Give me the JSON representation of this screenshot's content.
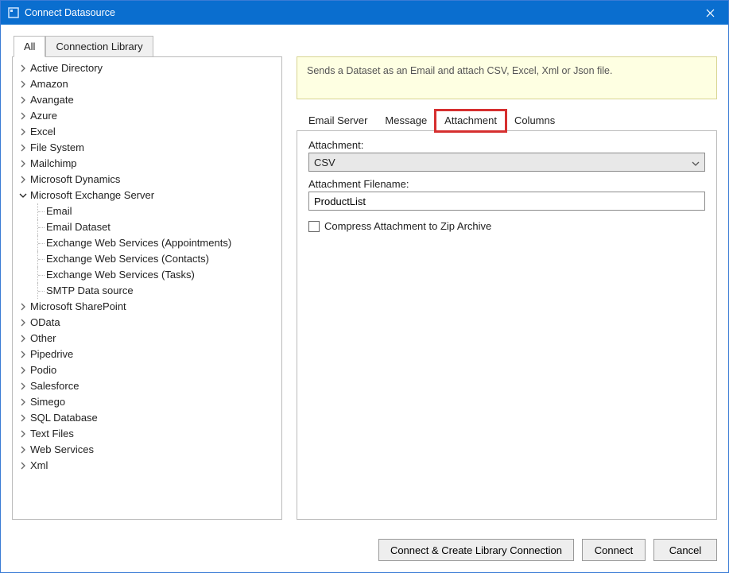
{
  "window": {
    "title": "Connect Datasource"
  },
  "mainTabs": {
    "active": 0,
    "items": [
      "All",
      "Connection Library"
    ]
  },
  "tree": {
    "items": [
      {
        "label": "Active Directory",
        "expanded": false
      },
      {
        "label": "Amazon",
        "expanded": false
      },
      {
        "label": "Avangate",
        "expanded": false
      },
      {
        "label": "Azure",
        "expanded": false
      },
      {
        "label": "Excel",
        "expanded": false
      },
      {
        "label": "File System",
        "expanded": false
      },
      {
        "label": "Mailchimp",
        "expanded": false
      },
      {
        "label": "Microsoft Dynamics",
        "expanded": false
      },
      {
        "label": "Microsoft Exchange Server",
        "expanded": true,
        "children": [
          {
            "label": "Email"
          },
          {
            "label": "Email Dataset"
          },
          {
            "label": "Exchange Web Services (Appointments)"
          },
          {
            "label": "Exchange Web Services (Contacts)"
          },
          {
            "label": "Exchange Web Services (Tasks)"
          },
          {
            "label": "SMTP Data source"
          }
        ]
      },
      {
        "label": "Microsoft SharePoint",
        "expanded": false
      },
      {
        "label": "OData",
        "expanded": false
      },
      {
        "label": "Other",
        "expanded": false
      },
      {
        "label": "Pipedrive",
        "expanded": false
      },
      {
        "label": "Podio",
        "expanded": false
      },
      {
        "label": "Salesforce",
        "expanded": false
      },
      {
        "label": "Simego",
        "expanded": false
      },
      {
        "label": "SQL Database",
        "expanded": false
      },
      {
        "label": "Text Files",
        "expanded": false
      },
      {
        "label": "Web Services",
        "expanded": false
      },
      {
        "label": "Xml",
        "expanded": false
      }
    ]
  },
  "infoBox": {
    "text": "Sends a Dataset as an Email and attach CSV, Excel, Xml or Json file."
  },
  "subTabs": {
    "active": 2,
    "items": [
      "Email Server",
      "Message",
      "Attachment",
      "Columns"
    ]
  },
  "form": {
    "attachment": {
      "label": "Attachment:",
      "value": "CSV"
    },
    "filename": {
      "label": "Attachment Filename:",
      "value": "ProductList"
    },
    "compress": {
      "label": "Compress Attachment to Zip Archive",
      "checked": false
    }
  },
  "footer": {
    "createLib": "Connect & Create Library Connection",
    "connect": "Connect",
    "cancel": "Cancel"
  }
}
